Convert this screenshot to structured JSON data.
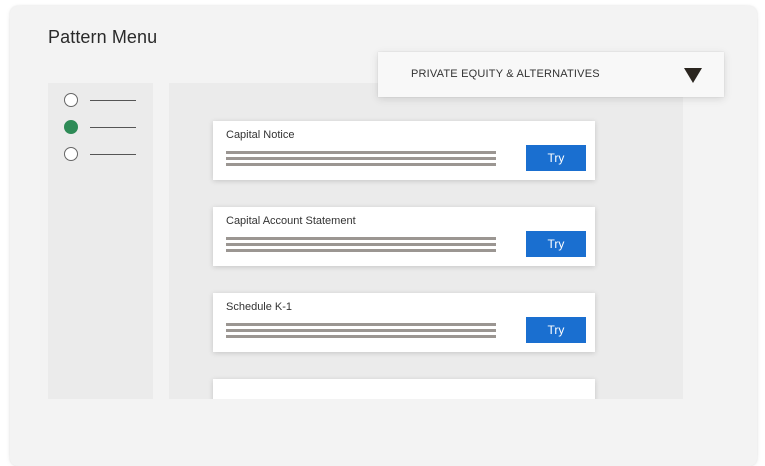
{
  "page": {
    "title": "Pattern Menu"
  },
  "dropdown": {
    "selected": "PRIVATE EQUITY & ALTERNATIVES",
    "icon": "caret-down-icon"
  },
  "sidebar": {
    "options": [
      {
        "selected": false
      },
      {
        "selected": true
      },
      {
        "selected": false
      }
    ],
    "selected_color": "#2e8b57"
  },
  "cards": [
    {
      "title": "Capital Notice",
      "button_label": "Try"
    },
    {
      "title": "Capital Account Statement",
      "button_label": "Try"
    },
    {
      "title": "Schedule K-1",
      "button_label": "Try"
    }
  ],
  "colors": {
    "accent": "#1a6fd0",
    "background": "#f3f3f3"
  }
}
